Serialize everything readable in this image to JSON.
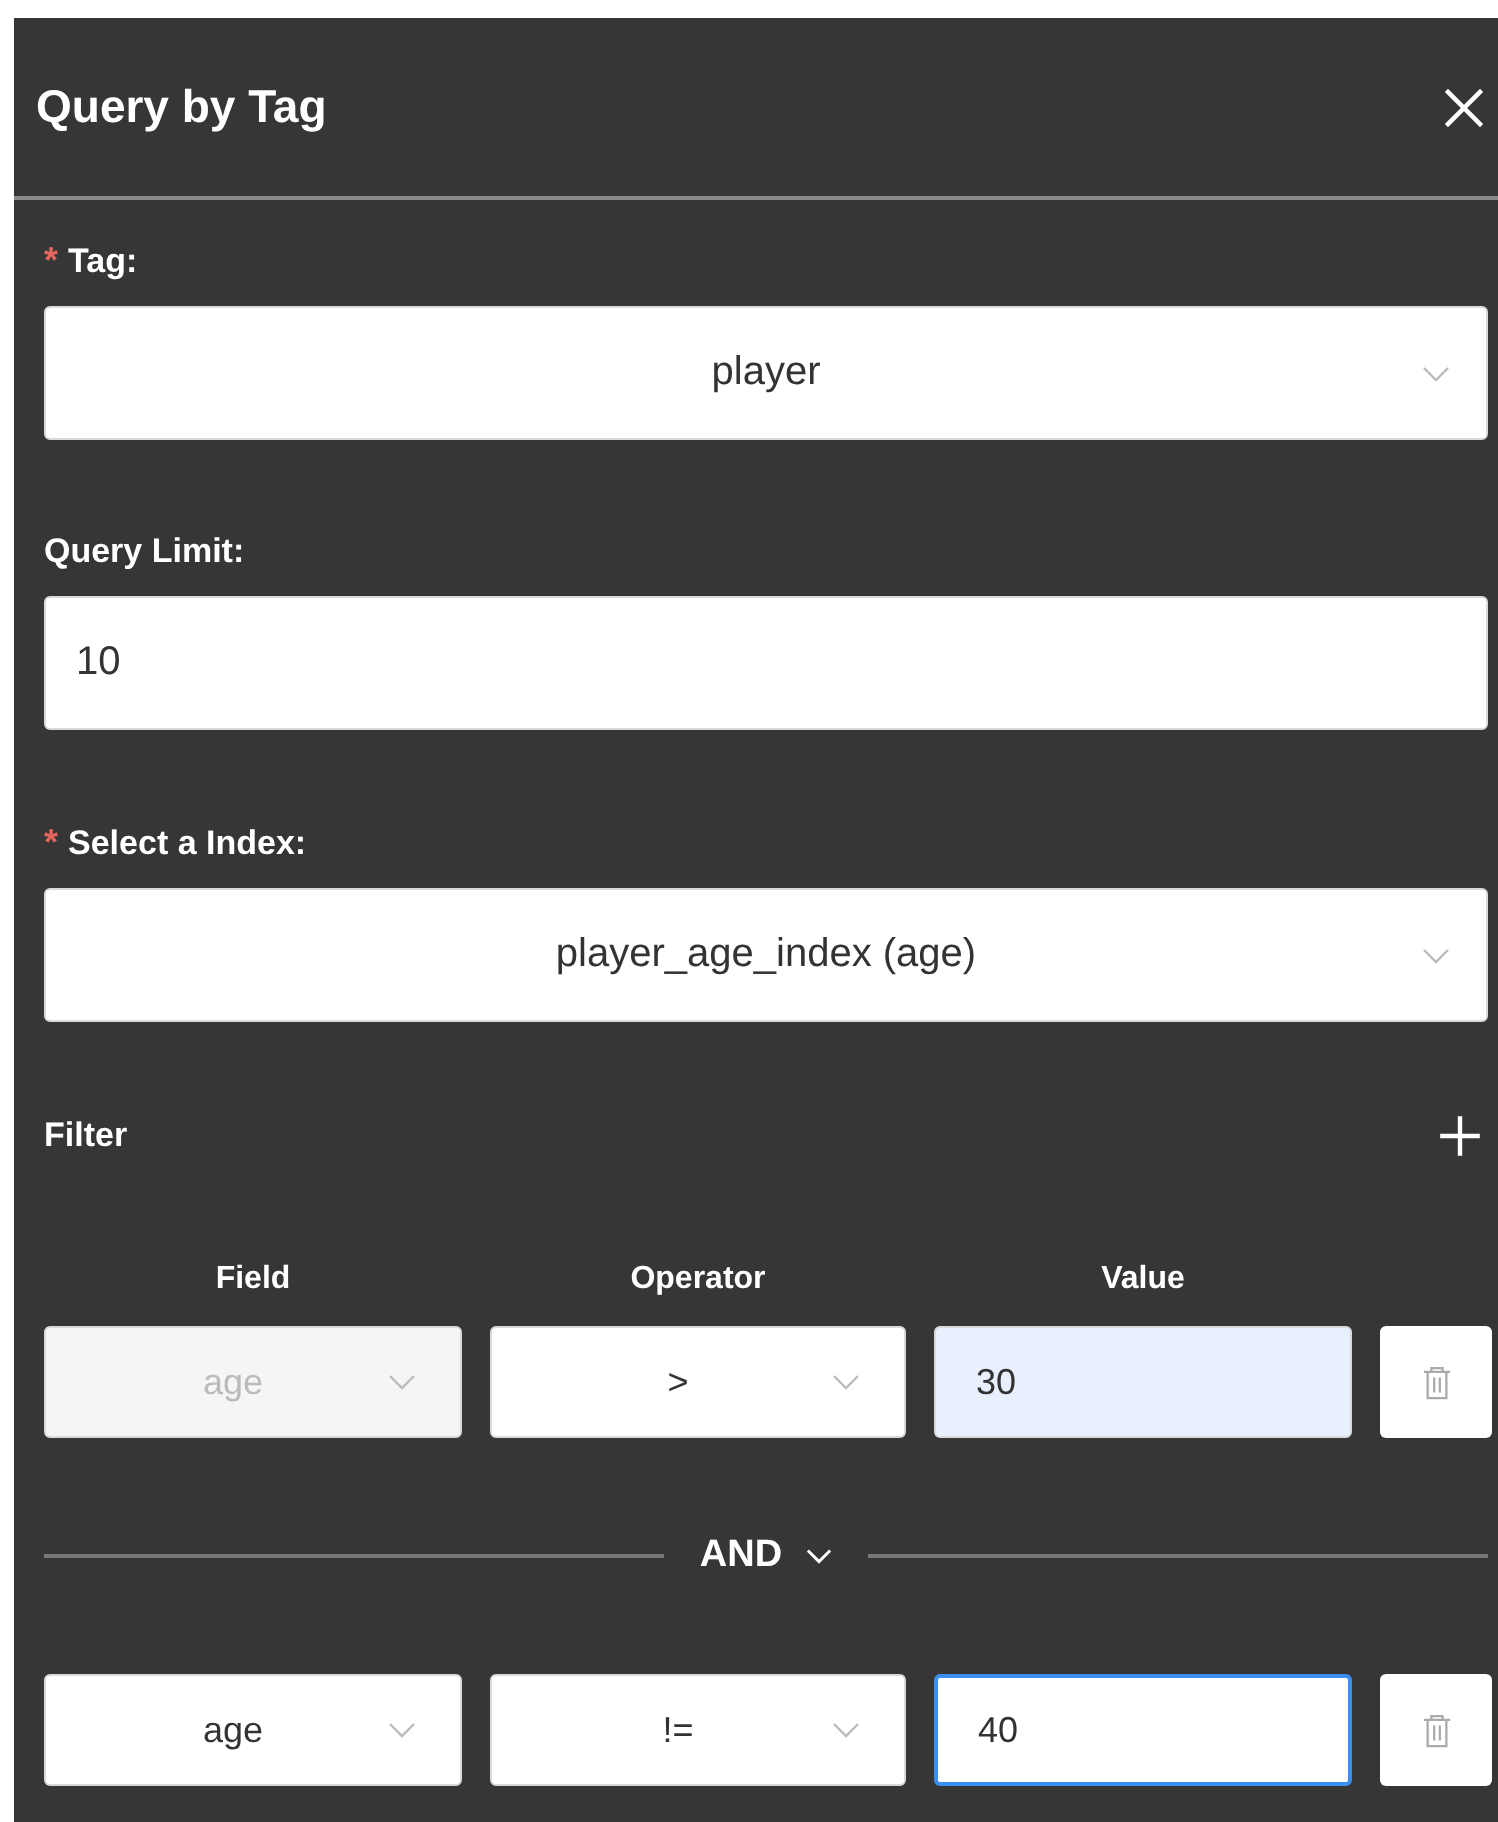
{
  "dialog": {
    "title": "Query by Tag"
  },
  "fields": [
    {
      "kind": "select",
      "label": "Tag:",
      "required_mark": "*",
      "value": "player"
    },
    {
      "kind": "input",
      "label": "Query Limit:",
      "value": "10"
    },
    {
      "kind": "select",
      "label": "Select a Index:",
      "required_mark": "*",
      "value": "player_age_index (age)"
    }
  ],
  "filter": {
    "title": "Filter",
    "columns": [
      "Field",
      "Operator",
      "Value"
    ],
    "rows": [
      {
        "field": "age",
        "field_disabled": true,
        "operator": ">",
        "value": "30",
        "value_autofilled": true,
        "value_focused": false
      },
      {
        "field": "age",
        "field_disabled": false,
        "operator": "!=",
        "value": "40",
        "value_autofilled": false,
        "value_focused": true
      }
    ],
    "conjunctions": [
      "AND"
    ]
  }
}
